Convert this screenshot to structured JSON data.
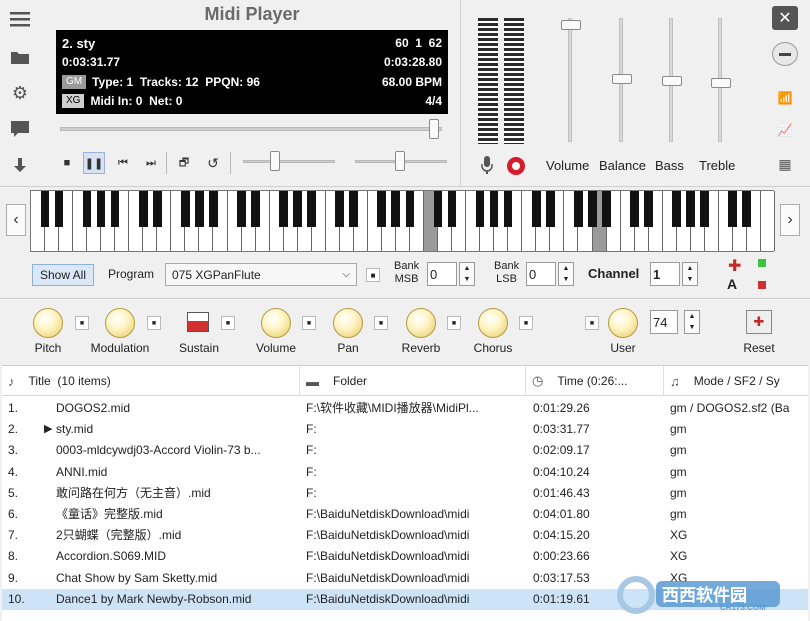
{
  "app": {
    "title": "Midi Player"
  },
  "display": {
    "song": "2. sty",
    "counter": "60  1  62",
    "elapsed": "0:03:31.77",
    "remaining": "0:03:28.80",
    "gm_tag": "GM",
    "info": "Type: 1  Tracks: 12  PPQN: 96",
    "bpm": "68.00 BPM",
    "xg_tag": "XG",
    "midi_in": "Midi In: 0  Net: 0",
    "timesig": "4/4"
  },
  "mixer": {
    "volume": "Volume",
    "balance": "Balance",
    "bass": "Bass",
    "treble": "Treble"
  },
  "controls": {
    "show_all": "Show All",
    "program_label": "Program",
    "program_value": "075 XGPanFlute",
    "bank_msb_label_1": "Bank",
    "bank_msb_label_2": "MSB",
    "bank_msb_value": "0",
    "bank_lsb_label_1": "Bank",
    "bank_lsb_label_2": "LSB",
    "bank_lsb_value": "0",
    "channel_label": "Channel",
    "channel_value": "1",
    "a_label": "A"
  },
  "knobs": {
    "pitch": "Pitch",
    "modulation": "Modulation",
    "sustain": "Sustain",
    "volume": "Volume",
    "pan": "Pan",
    "reverb": "Reverb",
    "chorus": "Chorus",
    "user": "User",
    "user_value": "74",
    "reset": "Reset"
  },
  "table": {
    "headers": {
      "title": "Title  (10 items)",
      "folder": "Folder",
      "time": "Time (0:26:...",
      "mode": "Mode / SF2 / Sy"
    },
    "rows": [
      {
        "num": "1.",
        "title": "DOGOS2.mid",
        "folder": "F:\\软件收藏\\MIDI播放器\\MidiPl...",
        "time": "0:01:29.26",
        "mode": "gm / DOGOS2.sf2 (Ba"
      },
      {
        "num": "2.",
        "title": "sty.mid",
        "folder": "F:",
        "time": "0:03:31.77",
        "mode": "gm"
      },
      {
        "num": "3.",
        "title": "0003-mldcywdj03-Accord Violin-73 b...",
        "folder": "F:",
        "time": "0:02:09.17",
        "mode": "gm"
      },
      {
        "num": "4.",
        "title": "ANNI.mid",
        "folder": "F:",
        "time": "0:04:10.24",
        "mode": "gm"
      },
      {
        "num": "5.",
        "title": "敢问路在何方（无主音）.mid",
        "folder": "F:",
        "time": "0:01:46.43",
        "mode": "gm"
      },
      {
        "num": "6.",
        "title": "《童话》完整版.mid",
        "folder": "F:\\BaiduNetdiskDownload\\midi",
        "time": "0:04:01.80",
        "mode": "gm"
      },
      {
        "num": "7.",
        "title": "2只蝴蝶（完整版）.mid",
        "folder": "F:\\BaiduNetdiskDownload\\midi",
        "time": "0:04:15.20",
        "mode": "XG"
      },
      {
        "num": "8.",
        "title": "Accordion.S069.MID",
        "folder": "F:\\BaiduNetdiskDownload\\midi",
        "time": "0:00:23.66",
        "mode": "XG"
      },
      {
        "num": "9.",
        "title": "Chat Show by Sam Sketty.mid",
        "folder": "F:\\BaiduNetdiskDownload\\midi",
        "time": "0:03:17.53",
        "mode": "XG"
      },
      {
        "num": "10.",
        "title": "Dance1 by Mark Newby-Robson.mid",
        "folder": "F:\\BaiduNetdiskDownload\\midi",
        "time": "0:01:19.61",
        "mode": ""
      }
    ]
  },
  "watermark": {
    "text_cn": "西西软件园",
    "text_en": "CR173.COM"
  }
}
